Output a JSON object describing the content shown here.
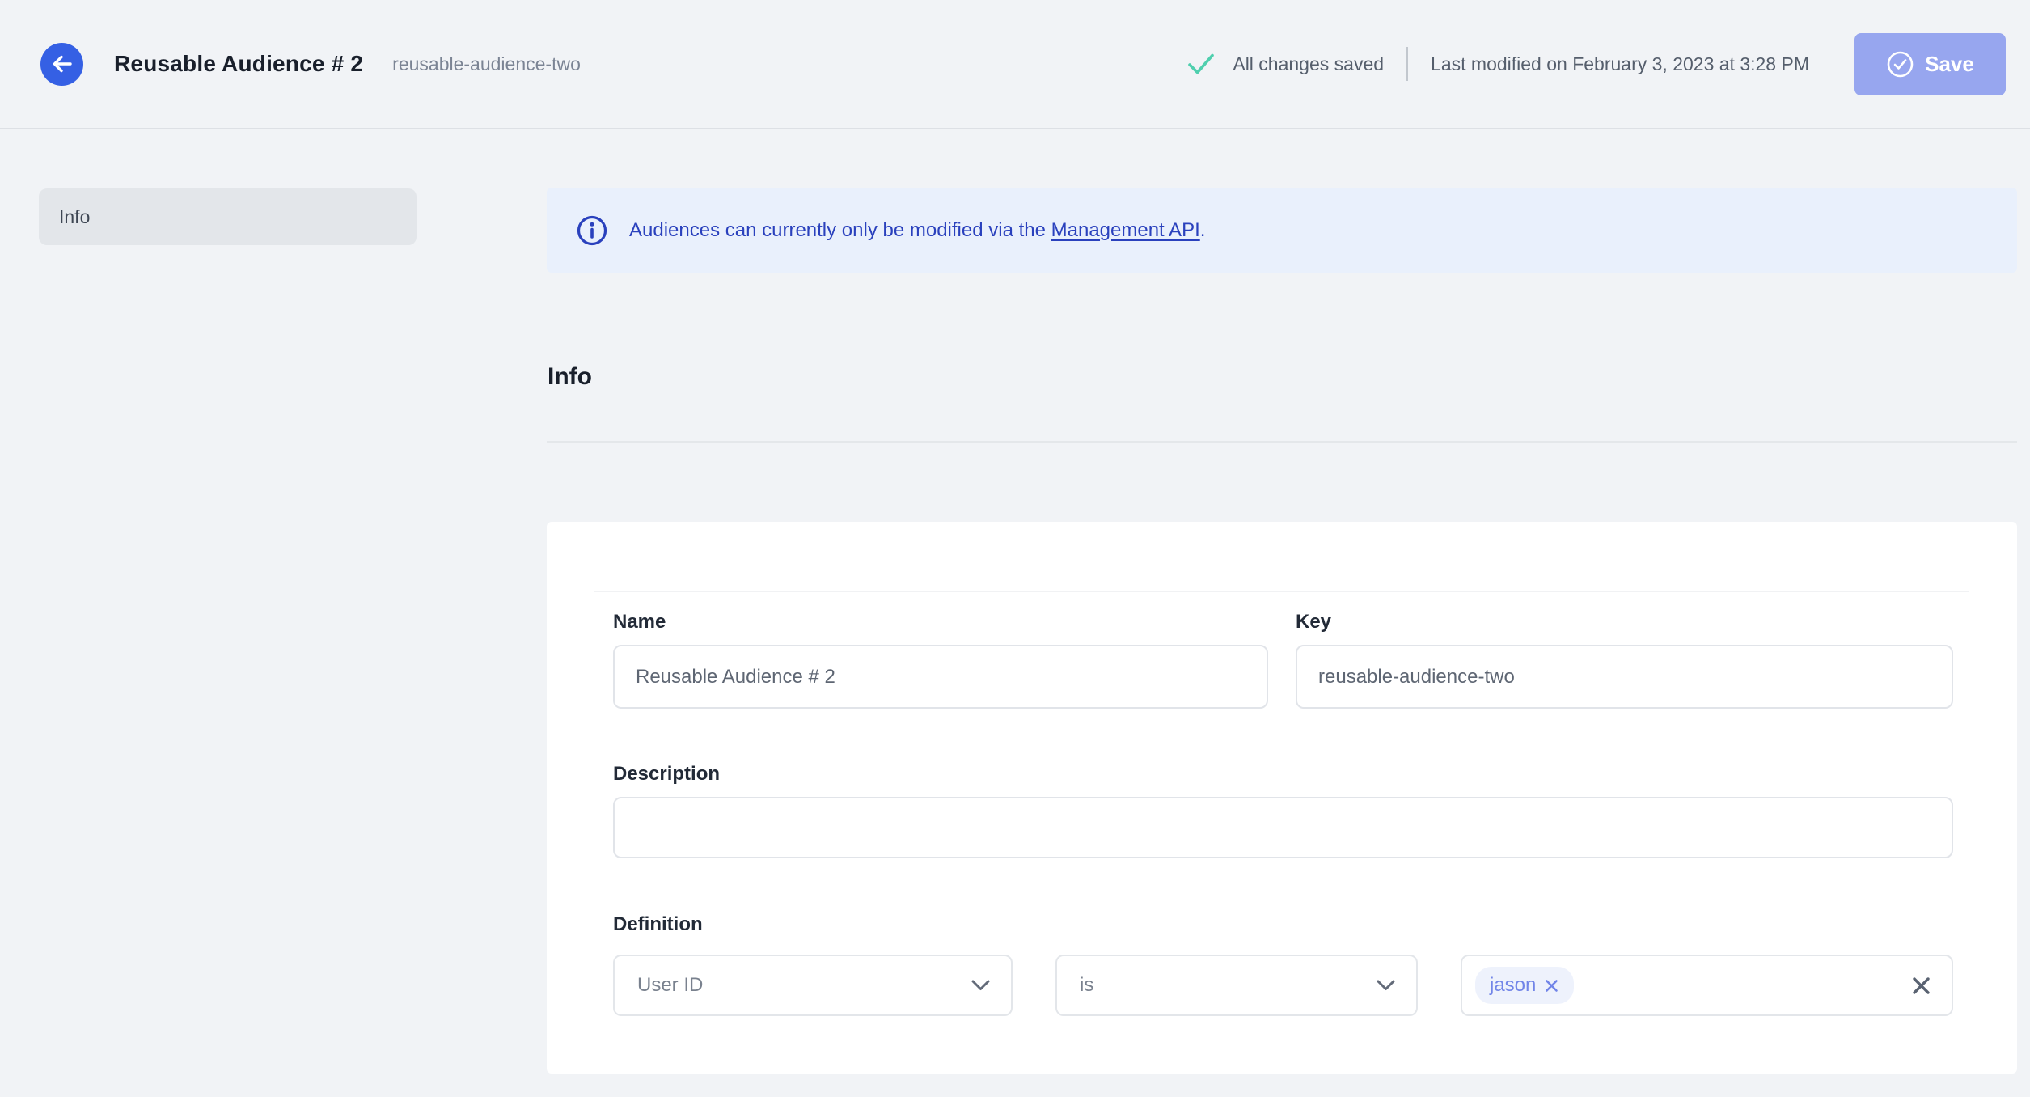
{
  "colors": {
    "page_bg": "#F1F3F6",
    "accent_blue": "#3560E4",
    "banner_bg": "#E9F0FC",
    "banner_text": "#2A41BD",
    "teal_check": "#4FCFAE",
    "save_button_bg": "#97A6EF",
    "tag_bg": "#EEF2FC",
    "tag_text": "#7285E8"
  },
  "header": {
    "title": "Reusable Audience # 2",
    "slug": "reusable-audience-two",
    "save_status": "All changes saved",
    "last_modified": "Last modified on February 3, 2023 at 3:28 PM",
    "save_label": "Save"
  },
  "sidebar": {
    "items": [
      {
        "label": "Info",
        "active": true
      }
    ]
  },
  "banner": {
    "text_before": "Audiences can currently only be modified via the ",
    "link_text": "Management API",
    "text_after": "."
  },
  "section": {
    "title": "Info"
  },
  "form": {
    "name": {
      "label": "Name",
      "value": "Reusable Audience # 2"
    },
    "key": {
      "label": "Key",
      "value": "reusable-audience-two"
    },
    "description": {
      "label": "Description",
      "value": ""
    },
    "definition": {
      "label": "Definition",
      "trait": "User ID",
      "operator": "is",
      "values": [
        "jason"
      ]
    }
  }
}
